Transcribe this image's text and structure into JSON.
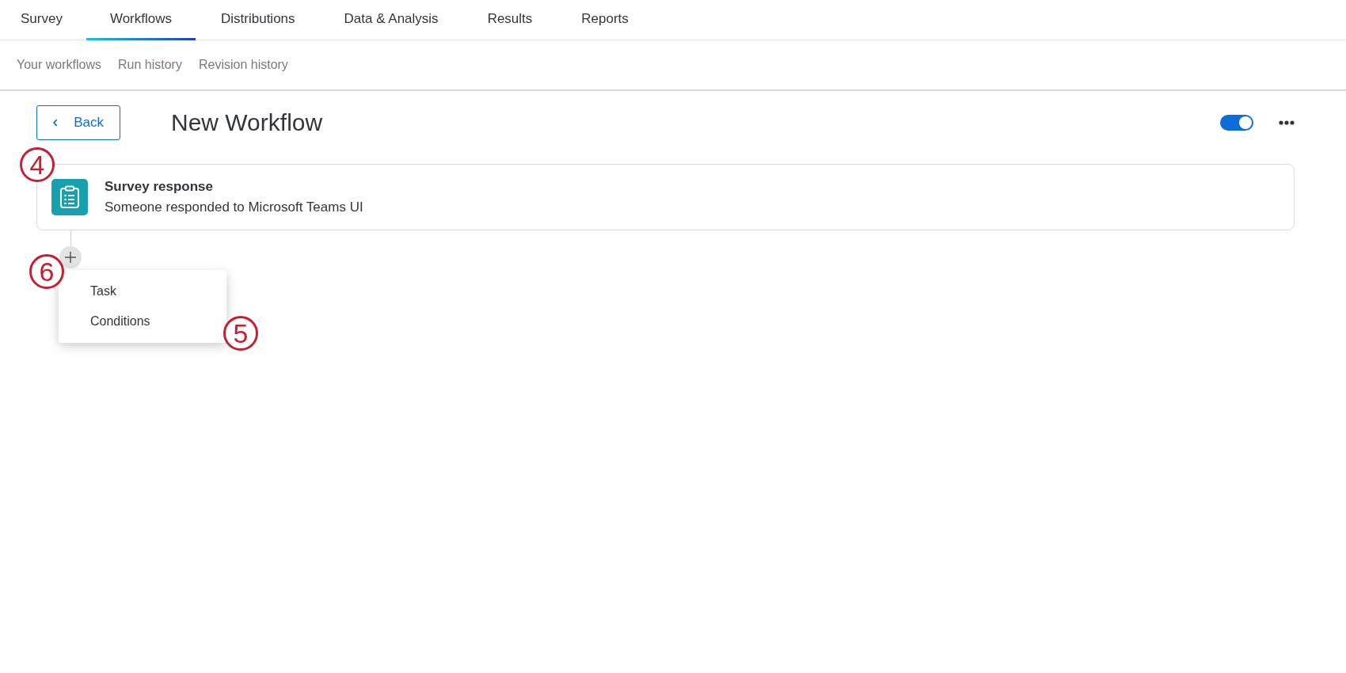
{
  "tabs": [
    {
      "label": "Survey",
      "selected": false
    },
    {
      "label": "Workflows",
      "selected": true
    },
    {
      "label": "Distributions",
      "selected": false
    },
    {
      "label": "Data & Analysis",
      "selected": false
    },
    {
      "label": "Results",
      "selected": false
    },
    {
      "label": "Reports",
      "selected": false
    }
  ],
  "subnav": [
    {
      "label": "Your workflows"
    },
    {
      "label": "Run history"
    },
    {
      "label": "Revision history"
    }
  ],
  "header": {
    "back_button": "Back",
    "title": "New Workflow",
    "enabled": {
      "on": true
    }
  },
  "trigger_card": {
    "callout": "4",
    "title": "Survey response",
    "description": "Someone responded to Microsoft Teams UI"
  },
  "add_button": {
    "callout": "6"
  },
  "add_menu": {
    "callout": "5",
    "items": [
      "Task",
      "Conditions"
    ]
  }
}
